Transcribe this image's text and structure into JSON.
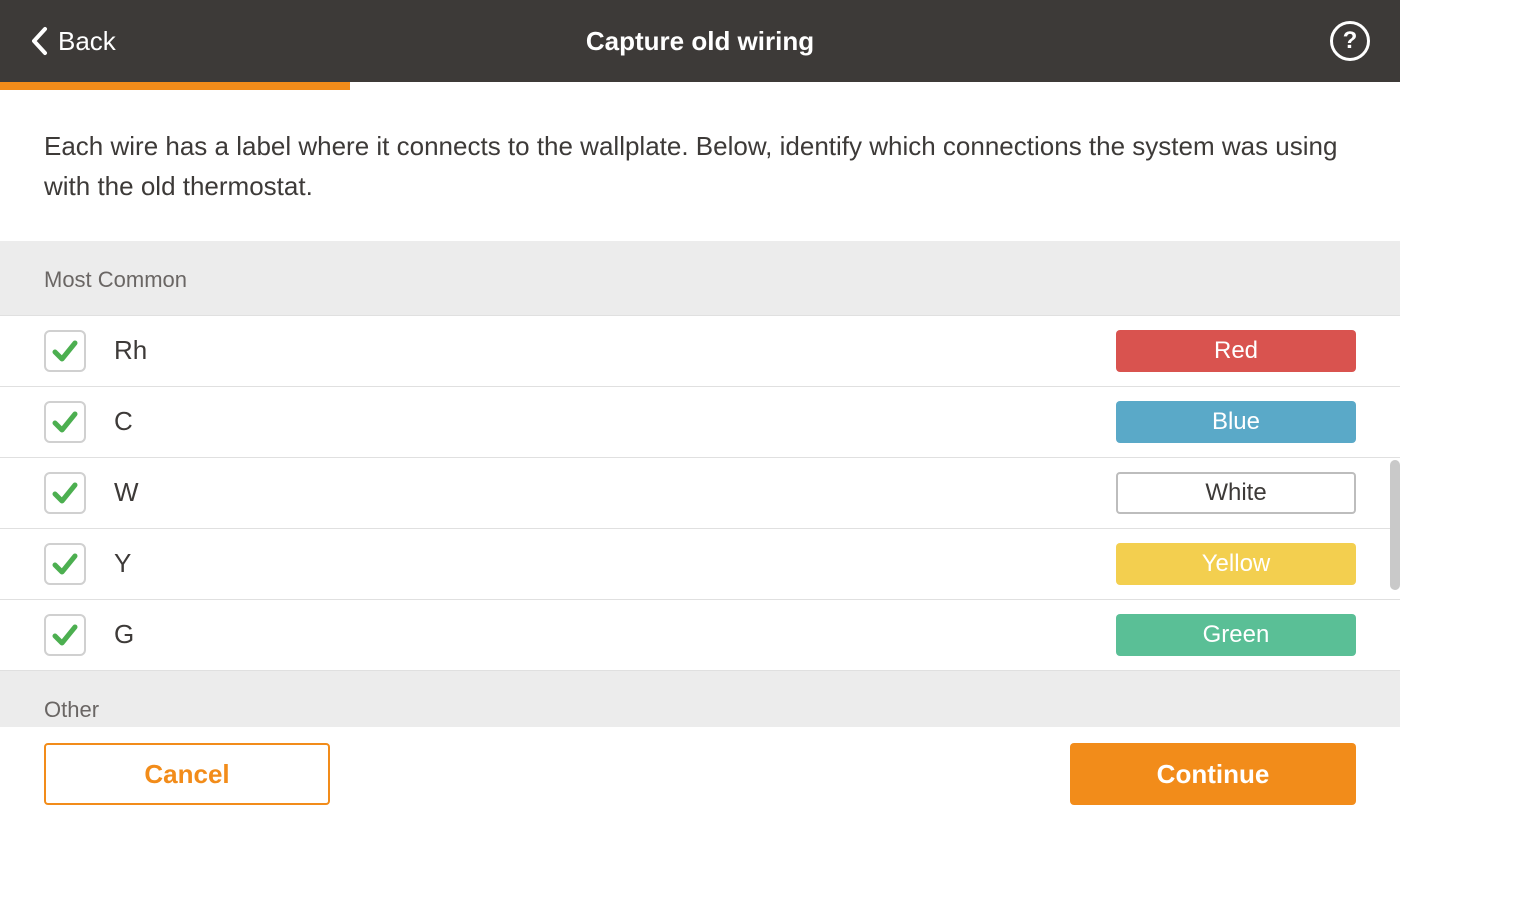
{
  "header": {
    "back_label": "Back",
    "title": "Capture old wiring",
    "help_label": "?"
  },
  "progress": {
    "percent": 25
  },
  "instructions": "Each wire has a label where it connects to the wallplate. Below, identify which connections the system was using with the old thermostat.",
  "sections": {
    "common_label": "Most Common",
    "other_label": "Other"
  },
  "wires": [
    {
      "label": "Rh",
      "checked": true,
      "color_name": "Red",
      "bg": "#d9534f",
      "fg": "#ffffff",
      "outline": false
    },
    {
      "label": "C",
      "checked": true,
      "color_name": "Blue",
      "bg": "#5aa9c8",
      "fg": "#ffffff",
      "outline": false
    },
    {
      "label": "W",
      "checked": true,
      "color_name": "White",
      "bg": "#ffffff",
      "fg": "#3d3a38",
      "outline": true
    },
    {
      "label": "Y",
      "checked": true,
      "color_name": "Yellow",
      "bg": "#f3cf4f",
      "fg": "#ffffff",
      "outline": false
    },
    {
      "label": "G",
      "checked": true,
      "color_name": "Green",
      "bg": "#5abf96",
      "fg": "#ffffff",
      "outline": false
    }
  ],
  "footer": {
    "cancel_label": "Cancel",
    "continue_label": "Continue"
  },
  "colors": {
    "accent": "#f28c1a",
    "check": "#4caf50"
  }
}
